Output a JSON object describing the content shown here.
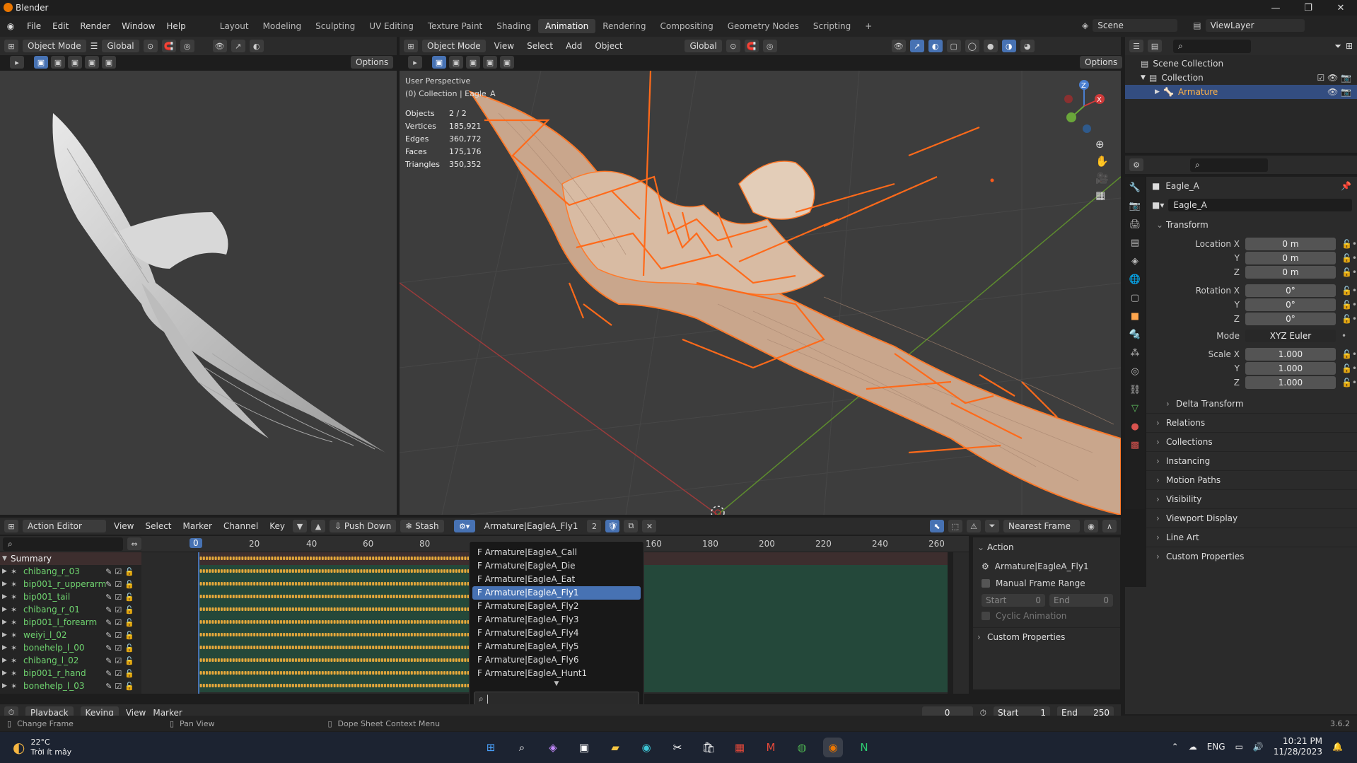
{
  "app": {
    "title": "Blender",
    "version": "3.6.2"
  },
  "menu": {
    "items": [
      "File",
      "Edit",
      "Render",
      "Window",
      "Help"
    ]
  },
  "workspaces": [
    "Layout",
    "Modeling",
    "Sculpting",
    "UV Editing",
    "Texture Paint",
    "Shading",
    "Animation",
    "Rendering",
    "Compositing",
    "Geometry Nodes",
    "Scripting"
  ],
  "active_workspace": "Animation",
  "scene": {
    "name": "Scene",
    "viewlayer": "ViewLayer"
  },
  "left_view": {
    "mode": "Object Mode",
    "transform": "Global",
    "options": "Options"
  },
  "main_view": {
    "mode": "Object Mode",
    "transform": "Global",
    "options": "Options",
    "menus": [
      "View",
      "Select",
      "Add",
      "Object"
    ],
    "perspective": "User Perspective",
    "collection": "(0) Collection | Eagle_A",
    "stats": [
      {
        "label": "Objects",
        "value": "2 / 2"
      },
      {
        "label": "Vertices",
        "value": "185,921"
      },
      {
        "label": "Edges",
        "value": "360,772"
      },
      {
        "label": "Faces",
        "value": "175,176"
      },
      {
        "label": "Triangles",
        "value": "350,352"
      }
    ]
  },
  "outliner": {
    "scene_collection": "Scene Collection",
    "collection": "Collection",
    "armature": "Armature"
  },
  "properties": {
    "object_name": "Eagle_A",
    "object_field": "Eagle_A",
    "transform_title": "Transform",
    "location_label": "Location X",
    "rotation_label": "Rotation X",
    "scale_label": "Scale X",
    "y_label": "Y",
    "z_label": "Z",
    "location": [
      "0 m",
      "0 m",
      "0 m"
    ],
    "rotation": [
      "0°",
      "0°",
      "0°"
    ],
    "mode_label": "Mode",
    "mode_value": "XYZ Euler",
    "scale": [
      "1.000",
      "1.000",
      "1.000"
    ],
    "delta": "Delta Transform",
    "sections": [
      "Relations",
      "Collections",
      "Instancing",
      "Motion Paths",
      "Visibility",
      "Viewport Display",
      "Line Art",
      "Custom Properties"
    ]
  },
  "dopesheet": {
    "editor": "Action Editor",
    "menus": [
      "View",
      "Select",
      "Marker",
      "Channel",
      "Key"
    ],
    "push_down": "Push Down",
    "stash": "Stash",
    "action": "Armature|EagleA_Fly1",
    "users": "2",
    "snap": "Nearest Frame",
    "current_frame_label": "0",
    "ruler_left": [
      "0",
      "20",
      "40",
      "60",
      "80"
    ],
    "ruler_right": [
      "160",
      "180",
      "200",
      "220",
      "240",
      "260"
    ],
    "summary": "Summary",
    "channels": [
      "chibang_r_03",
      "bip001_r_upperarm",
      "bip001_tail",
      "chibang_r_01",
      "bip001_l_forearm",
      "weiyi_l_02",
      "bonehelp_l_00",
      "chibang_l_02",
      "bip001_r_hand",
      "bonehelp_l_03"
    ]
  },
  "action_dropdown": {
    "items": [
      "F Armature|EagleA_Call",
      "F Armature|EagleA_Die",
      "F Armature|EagleA_Eat",
      "F Armature|EagleA_Fly1",
      "F Armature|EagleA_Fly2",
      "F Armature|EagleA_Fly3",
      "F Armature|EagleA_Fly4",
      "F Armature|EagleA_Fly5",
      "F Armature|EagleA_Fly6",
      "F Armature|EagleA_Hunt1"
    ],
    "selected_index": 3
  },
  "action_panel": {
    "title": "Action",
    "name": "Armature|EagleA_Fly1",
    "manual_range": "Manual Frame Range",
    "start_label": "Start",
    "start_value": "0",
    "end_label": "End",
    "end_value": "0",
    "cyclic": "Cyclic Animation",
    "custom_props": "Custom Properties"
  },
  "timeline": {
    "menus": [
      "Playback",
      "Keying",
      "View",
      "Marker"
    ],
    "frame": "0",
    "start_label": "Start",
    "start": "1",
    "end_label": "End",
    "end": "250"
  },
  "statusbar": {
    "left": "Change Frame",
    "mid": "Pan View",
    "right": "Dope Sheet Context Menu"
  },
  "taskbar": {
    "weather_temp": "22°C",
    "weather_desc": "Trời ít mây",
    "lang": "ENG",
    "time": "10:21 PM",
    "date": "11/28/2023"
  },
  "colors": {
    "accent": "#4772b3",
    "bone": "#ff6a1a",
    "channel_green": "#6fd36f",
    "keyframe": "#e8a93a"
  }
}
